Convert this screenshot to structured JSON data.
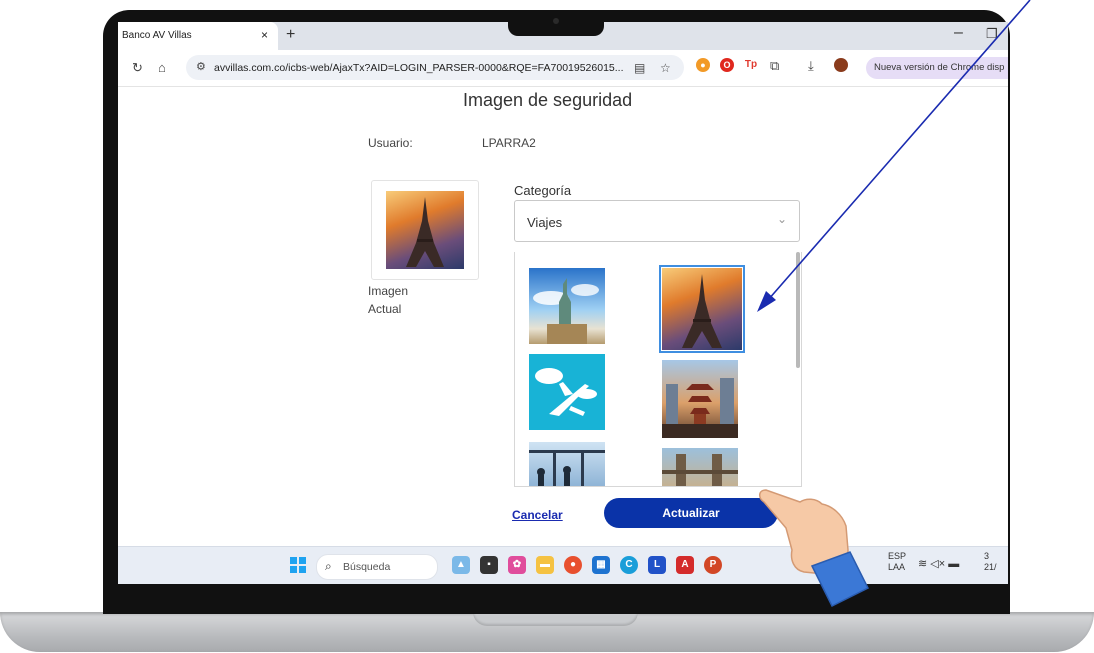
{
  "browser": {
    "tab_title": "Banco AV Villas",
    "tab_close": "×",
    "new_tab": "+",
    "minimize": "–",
    "url": "avvillas.com.co/icbs-web/AjaxTx?AID=LOGIN_PARSER-0000&RQE=FA70019526015...",
    "update_notice": "Nueva versión de Chrome disp",
    "icons": [
      "reload-icon",
      "home-icon",
      "site-settings-icon",
      "translate-icon",
      "bookmark-star-icon",
      "extension-icon",
      "download-icon",
      "profile-avatar-icon"
    ]
  },
  "page": {
    "title": "Imagen de seguridad",
    "user_label": "Usuario:",
    "user_value": "LPARRA2",
    "current_image_label_1": "Imagen",
    "current_image_label_2": "Actual",
    "category_label": "Categoría",
    "category_value": "Viajes",
    "gallery_images": [
      "statue-of-liberty",
      "eiffel-tower",
      "airplane",
      "pagoda-city",
      "airport-window",
      "tower-bridge"
    ],
    "selected_image": "eiffel-tower",
    "cancel_label": "Cancelar",
    "update_label": "Actualizar"
  },
  "taskbar": {
    "search_placeholder": "Búsqueda",
    "lang_1": "ESP",
    "lang_2": "LAA",
    "clock_1": "3",
    "clock_2": "21/"
  },
  "colors": {
    "primary_button": "#0a33a8",
    "link": "#1a2bb0",
    "selection": "#3f8ee0",
    "annotation_arrow": "#1a2bb0"
  }
}
